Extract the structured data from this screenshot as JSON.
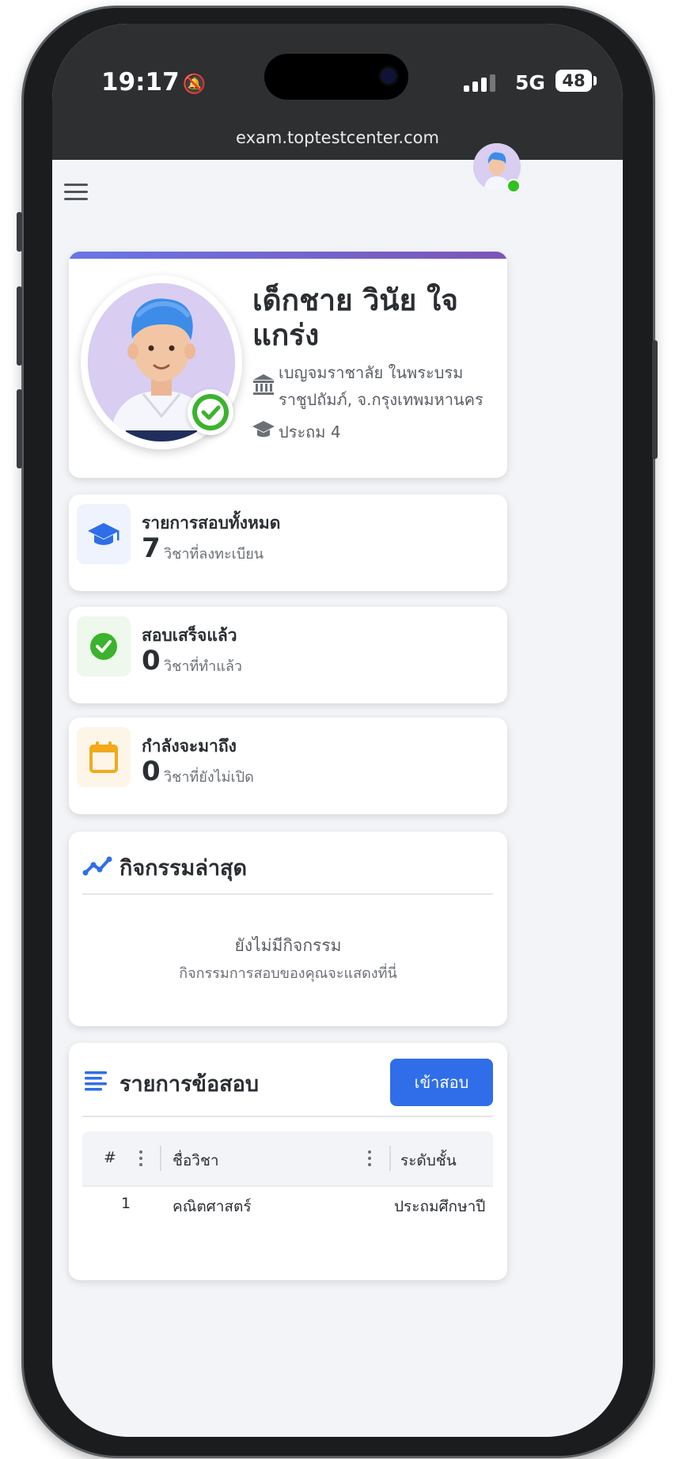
{
  "status_bar": {
    "time": "19:17",
    "network": "5G",
    "battery": "48"
  },
  "browser": {
    "url": "exam.toptestcenter.com"
  },
  "profile": {
    "name": "เด็กชาย วินัย ใจแกร่ง",
    "school": "เบญจมราชาลัย ในพระบรมราชูปถัมภ์, จ.กรุงเทพมหานคร",
    "grade": "ประถม 4"
  },
  "stats": [
    {
      "title": "รายการสอบทั้งหมด",
      "value": "7",
      "unit": "วิชาที่ลงทะเบียน",
      "icon": "graduation-cap-icon",
      "color": "#2f6ee8"
    },
    {
      "title": "สอบเสร็จแล้ว",
      "value": "0",
      "unit": "วิชาที่ทำแล้ว",
      "icon": "check-circle-icon",
      "color": "#3bb32d"
    },
    {
      "title": "กำลังจะมาถึง",
      "value": "0",
      "unit": "วิชาที่ยังไม่เปิด",
      "icon": "calendar-icon",
      "color": "#f2a91c"
    }
  ],
  "activity": {
    "title": "กิจกรรมล่าสุด",
    "empty_title": "ยังไม่มีกิจกรรม",
    "empty_subtitle": "กิจกรรมการสอบของคุณจะแสดงที่นี่"
  },
  "exams": {
    "title": "รายการข้อสอบ",
    "enter_button": "เข้าสอบ",
    "columns": [
      "#",
      "ชื่อวิชา",
      "ระดับชั้น"
    ],
    "rows": [
      {
        "no": "1",
        "subject": "คณิตศาสตร์",
        "level": "ประถมศึกษาปี"
      }
    ]
  },
  "colors": {
    "accent": "#2f6ee8",
    "gradient_start": "#6a76e4",
    "gradient_end": "#7c55b6",
    "online": "#2fc21f"
  }
}
